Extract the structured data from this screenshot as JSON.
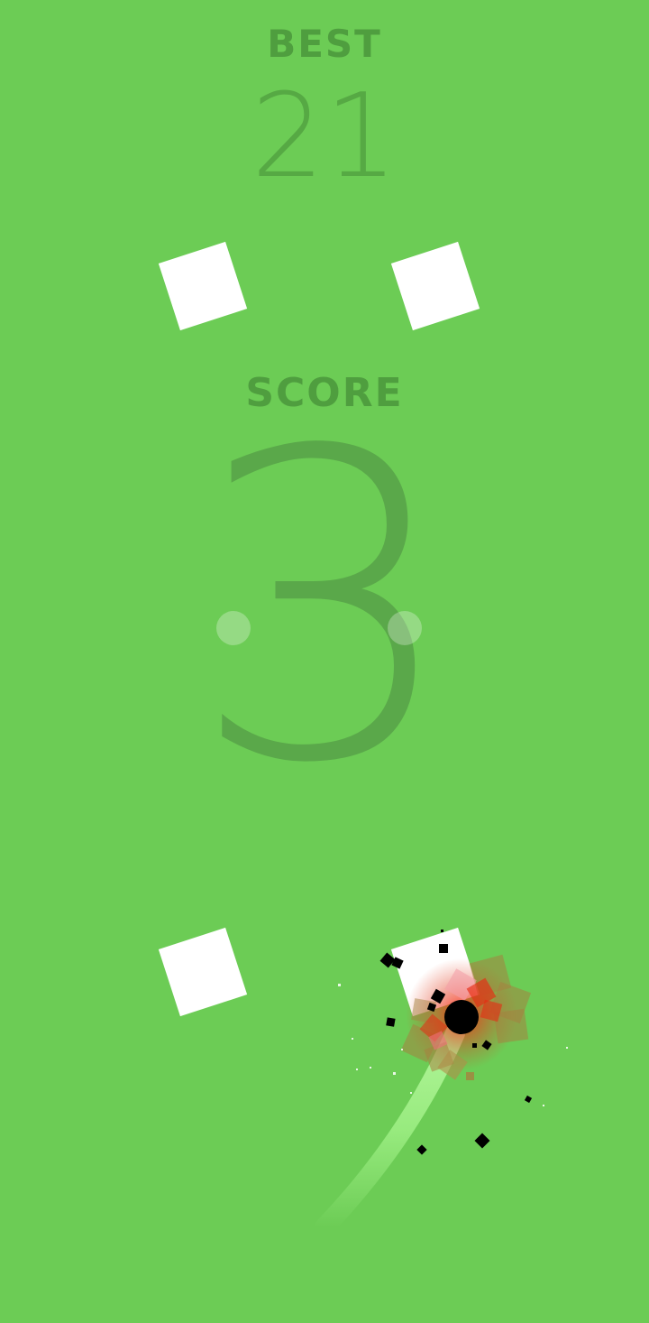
{
  "hud": {
    "best_label": "BEST",
    "best_value": "21",
    "score_label": "SCORE",
    "score_value": "3"
  },
  "colors": {
    "background": "#6ccc55",
    "text": "#4f9e3f",
    "tile": "#ffffff",
    "ball": "#000000",
    "trail": "#a6f58c",
    "burst": "#e23b1e"
  }
}
